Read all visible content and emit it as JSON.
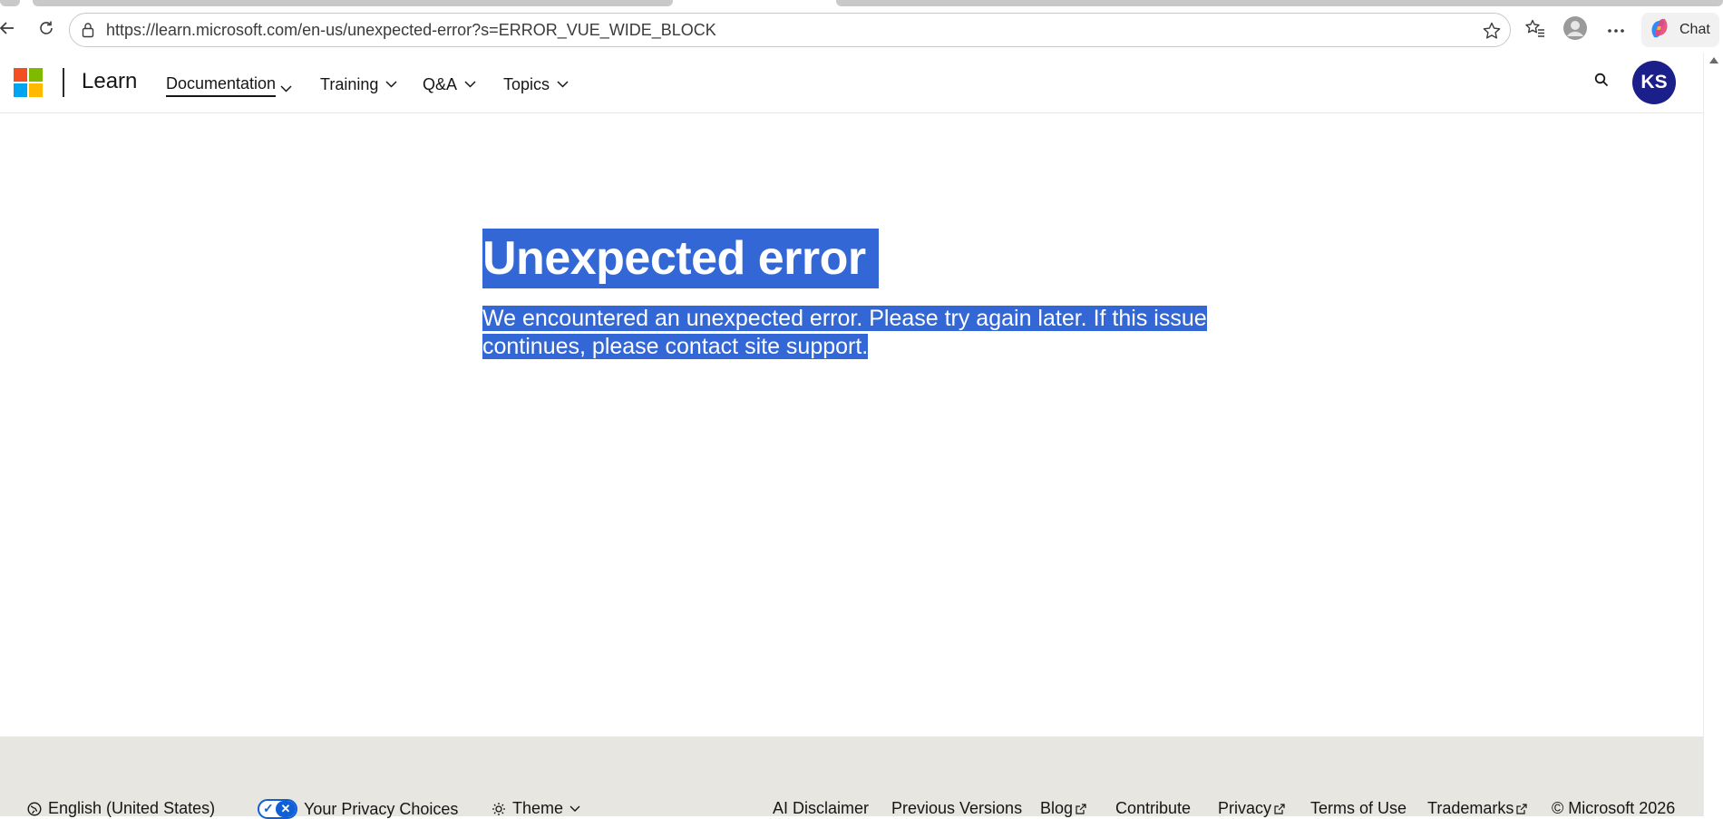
{
  "browser": {
    "url": "https://learn.microsoft.com/en-us/unexpected-error?s=ERROR_VUE_WIDE_BLOCK",
    "chat_label": "Chat",
    "icons": [
      "back-arrow-icon",
      "refresh-icon",
      "lock-icon",
      "star-icon",
      "favorites-icon",
      "profile-icon",
      "more-icon",
      "copilot-icon"
    ]
  },
  "header": {
    "brand": "Learn",
    "nav": [
      {
        "label": "Documentation",
        "active": true
      },
      {
        "label": "Training"
      },
      {
        "label": "Q&A"
      },
      {
        "label": "Topics"
      }
    ],
    "avatar_initials": "KS",
    "colors": {
      "avatar_bg": "#1b1f8a"
    }
  },
  "main": {
    "title": "Unexpected error",
    "message": "We encountered an unexpected error. Please try again later. If this issue continues, please contact site support.",
    "colors": {
      "selection_highlight": "#3367d6"
    }
  },
  "footer": {
    "language": "English (United States)",
    "privacy_choices": "Your Privacy Choices",
    "theme": "Theme",
    "links": [
      {
        "label": "AI Disclaimer"
      },
      {
        "label": "Previous Versions"
      },
      {
        "label": "Blog",
        "external": true
      },
      {
        "label": "Contribute"
      },
      {
        "label": "Privacy",
        "external": true
      },
      {
        "label": "Terms of Use"
      },
      {
        "label": "Trademarks",
        "external": true
      }
    ],
    "copyright": "© Microsoft 2026",
    "colors": {
      "background": "#e8e6e1"
    }
  }
}
